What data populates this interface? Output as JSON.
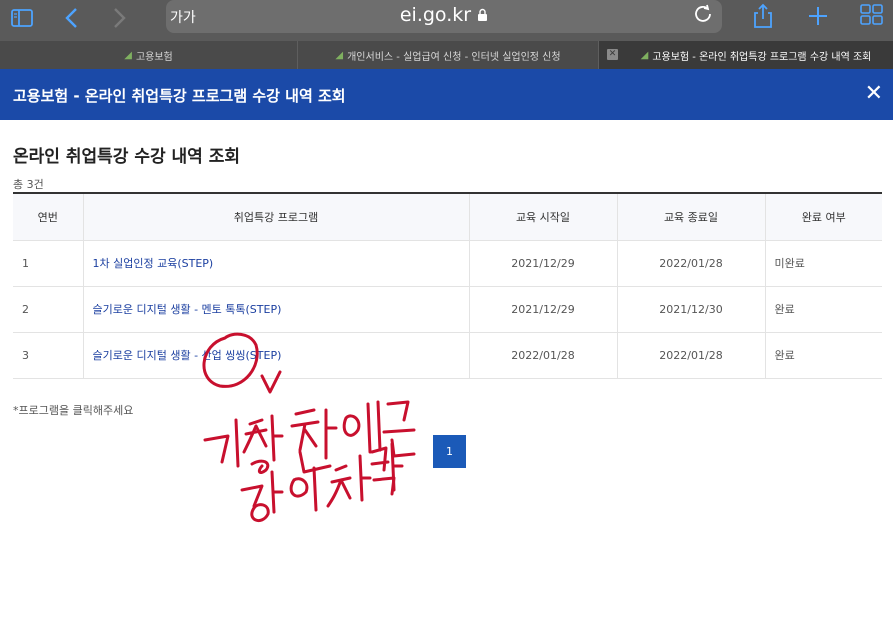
{
  "browser": {
    "text_size_label": "가가",
    "url": "ei.go.kr",
    "tabs": [
      {
        "label": "고용보험"
      },
      {
        "label": "개인서비스 - 실업급여 신청 - 인터넷 실업인정 신청"
      },
      {
        "label": "고용보험 - 온라인 취업특강 프로그램 수강 내역 조회"
      }
    ]
  },
  "header": {
    "title": "고용보험 - 온라인 취업특강 프로그램 수강 내역 조회",
    "close": "✕"
  },
  "page": {
    "title": "온라인 취업특강 수강 내역 조회",
    "count": "총 3건",
    "note": "*프로그램을 클릭해주세요"
  },
  "table": {
    "headers": [
      "연번",
      "취업특강 프로그램",
      "교육 시작일",
      "교육 종료일",
      "완료 여부"
    ],
    "rows": [
      {
        "no": "1",
        "program": "1차 실업인정 교육(STEP)",
        "start": "2021/12/29",
        "end": "2022/01/28",
        "status": "미완료"
      },
      {
        "no": "2",
        "program": "슬기로운 디지털 생활 - 멘토 톡톡(STEP)",
        "start": "2021/12/29",
        "end": "2021/12/30",
        "status": "완료"
      },
      {
        "no": "3",
        "program": "슬기로운 디지털 생활 - 산업 씽씽(STEP)",
        "start": "2022/01/28",
        "end": "2022/01/28",
        "status": "완료"
      }
    ]
  },
  "pagination": {
    "current": "1"
  },
  "annotation": {
    "handwriting": "가장 최근에 들은 강의 선택",
    "color": "#c8102e"
  }
}
